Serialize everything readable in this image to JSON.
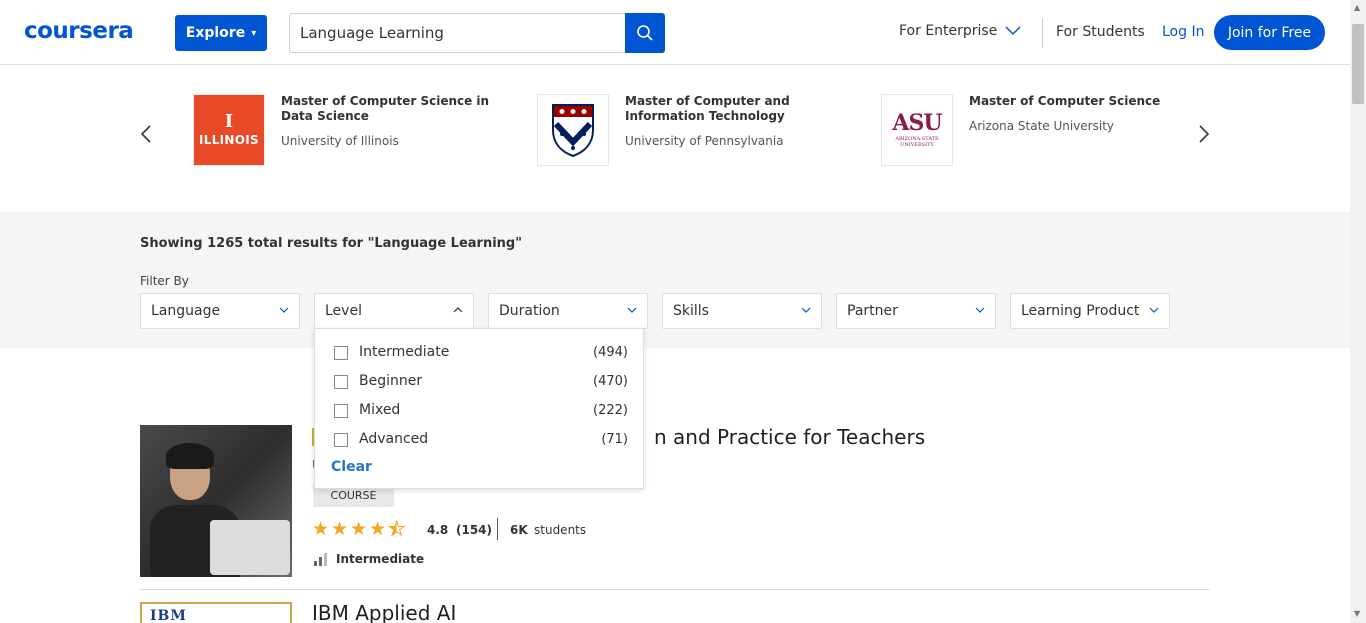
{
  "header": {
    "logo": "coursera",
    "explore_label": "Explore",
    "search_value": "Language Learning",
    "nav_enterprise": "For Enterprise",
    "nav_students": "For Students",
    "nav_login": "Log In",
    "join_label": "Join for Free"
  },
  "carousel": {
    "items": [
      {
        "title": "Master of Computer Science in Data Science",
        "university": "University of Illinois",
        "logo_text_big": "I",
        "logo_text_small": "ILLINOIS"
      },
      {
        "title": "Master of Computer and Information Technology",
        "university": "University of Pennsylvania"
      },
      {
        "title": "Master of Computer Science",
        "university": "Arizona State University",
        "logo_text_big": "ASU",
        "logo_text_small": "ARIZONA STATE UNIVERSITY"
      }
    ]
  },
  "results": {
    "summary": "Showing 1265 total results for \"Language Learning\"",
    "filter_by": "Filter By",
    "filters": [
      "Language",
      "Level",
      "Duration",
      "Skills",
      "Partner",
      "Learning Product"
    ]
  },
  "level_dropdown": {
    "options": [
      {
        "label": "Intermediate",
        "count": "(494)"
      },
      {
        "label": "Beginner",
        "count": "(470)"
      },
      {
        "label": "Mixed",
        "count": "(222)"
      },
      {
        "label": "Advanced",
        "count": "(71)"
      }
    ],
    "clear_label": "Clear"
  },
  "courses": [
    {
      "title_visible": "n and Practice for Teachers",
      "partner_initial": "U",
      "badge": "COURSE",
      "rating": "4.8",
      "rating_count": "(154)",
      "students_num": "6K",
      "students_label": "students",
      "level": "Intermediate"
    },
    {
      "title_visible": "IBM Applied AI",
      "logo_text": "IBM"
    }
  ],
  "colors": {
    "brand": "#0056d2",
    "star": "#f5a623",
    "illinois": "#e84a27",
    "asu": "#8c1d40"
  }
}
